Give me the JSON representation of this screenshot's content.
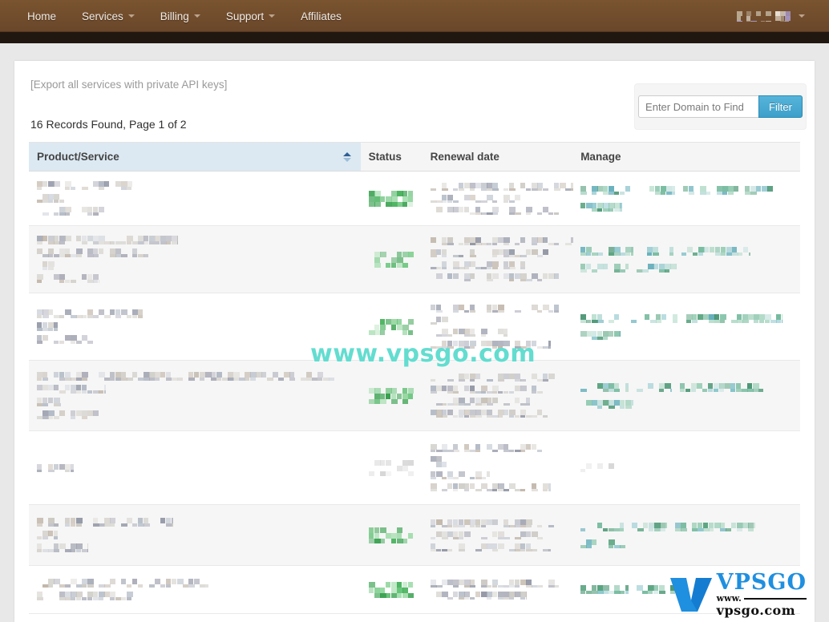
{
  "nav": {
    "items": [
      {
        "label": "Home",
        "has_caret": false,
        "name": "nav-item-home"
      },
      {
        "label": "Services",
        "has_caret": true,
        "name": "nav-item-services"
      },
      {
        "label": "Billing",
        "has_caret": true,
        "name": "nav-item-billing"
      },
      {
        "label": "Support",
        "has_caret": true,
        "name": "nav-item-support"
      },
      {
        "label": "Affiliates",
        "has_caret": false,
        "name": "nav-item-affiliates"
      }
    ],
    "user_menu_label": "",
    "background_color": "#6a472a",
    "band_color": "#201710"
  },
  "page": {
    "export_link": "[Export all services with private API keys]",
    "records_line": "16 Records Found, Page 1 of 2",
    "records_found": 16,
    "page_current": 1,
    "page_total": 2
  },
  "filter": {
    "placeholder": "Enter Domain to Find",
    "value": "",
    "button_label": "Filter",
    "button_color": "#3ea0ca",
    "panel_color": "#f5f5f5"
  },
  "table": {
    "columns": [
      {
        "label": "Product/Service",
        "sorted": true,
        "sort_direction": "asc",
        "width": "43%"
      },
      {
        "label": "Status",
        "sorted": false,
        "sort_direction": "",
        "width": "8%"
      },
      {
        "label": "Renewal date",
        "sorted": false,
        "sort_direction": "",
        "width": "19.5%"
      },
      {
        "label": "Manage",
        "sorted": false,
        "sort_direction": "",
        "width": "29.5%"
      }
    ],
    "header_sorted_color": "#dce9f2",
    "header_color": "#f5f5f5",
    "alt_row_color": "#f6f6f6",
    "redacted": true,
    "rows": [
      {
        "product": "",
        "status": "",
        "status_type": "active",
        "renewal": "",
        "manage": "",
        "alt": false
      },
      {
        "product": "",
        "status": "",
        "status_type": "active",
        "renewal": "",
        "manage": "",
        "alt": true
      },
      {
        "product": "",
        "status": "",
        "status_type": "active",
        "renewal": "",
        "manage": "",
        "alt": false
      },
      {
        "product": "",
        "status": "",
        "status_type": "active",
        "renewal": "",
        "manage": "",
        "alt": true
      },
      {
        "product": "",
        "status": "",
        "status_type": "inactive",
        "renewal": "",
        "manage": "",
        "alt": false
      },
      {
        "product": "",
        "status": "",
        "status_type": "active",
        "renewal": "",
        "manage": "",
        "alt": true
      },
      {
        "product": "",
        "status": "",
        "status_type": "active",
        "renewal": "",
        "manage": "",
        "alt": false
      }
    ]
  },
  "watermark": {
    "center_text": "www.vpsgo.com",
    "center_color": "#63ddd0",
    "logo_brand": "VPSGO",
    "logo_www": "www.",
    "logo_domain": "vpsgo.com",
    "logo_color": "#1f8fe0"
  }
}
